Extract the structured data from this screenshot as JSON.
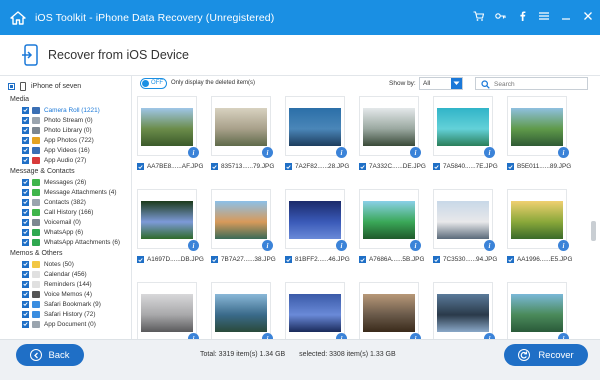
{
  "window": {
    "title": "iOS Toolkit - iPhone Data Recovery (Unregistered)",
    "tools": [
      "cart-icon",
      "key-icon",
      "facebook-icon",
      "menu-icon",
      "minimize-icon",
      "close-icon"
    ]
  },
  "header": {
    "title": "Recover from iOS Device"
  },
  "sidebar": {
    "device": "iPhone of seven",
    "groups": [
      {
        "title": "Media",
        "items": [
          {
            "label": "Camera Roll (1221)",
            "icon_color": "#3a6fb4",
            "active": true
          },
          {
            "label": "Photo Stream (0)",
            "icon_color": "#9aa4ae"
          },
          {
            "label": "Photo Library (0)",
            "icon_color": "#7d8791"
          },
          {
            "label": "App Photos (722)",
            "icon_color": "#e5a321"
          },
          {
            "label": "App Videos (16)",
            "icon_color": "#3a6fb4"
          },
          {
            "label": "App Audio (27)",
            "icon_color": "#d83a3a"
          }
        ]
      },
      {
        "title": "Message & Contacts",
        "items": [
          {
            "label": "Messages (26)",
            "icon_color": "#3fb54a"
          },
          {
            "label": "Message Attachments (4)",
            "icon_color": "#3fb54a"
          },
          {
            "label": "Contacts (382)",
            "icon_color": "#9aa4ae"
          },
          {
            "label": "Call History (166)",
            "icon_color": "#3fb54a"
          },
          {
            "label": "Voicemail (0)",
            "icon_color": "#7d8791"
          },
          {
            "label": "WhatsApp (6)",
            "icon_color": "#2fa84f"
          },
          {
            "label": "WhatsApp Attachments (6)",
            "icon_color": "#2fa84f"
          }
        ]
      },
      {
        "title": "Memos & Others",
        "items": [
          {
            "label": "Notes (50)",
            "icon_color": "#f2c744"
          },
          {
            "label": "Calendar (456)",
            "icon_color": "#e0e0e0"
          },
          {
            "label": "Reminders (144)",
            "icon_color": "#e0e0e0"
          },
          {
            "label": "Voice Memos (4)",
            "icon_color": "#555555"
          },
          {
            "label": "Safari Bookmark (9)",
            "icon_color": "#3a8de0"
          },
          {
            "label": "Safari History (72)",
            "icon_color": "#3a8de0"
          },
          {
            "label": "App Document (0)",
            "icon_color": "#9aa4ae"
          }
        ]
      }
    ]
  },
  "filter": {
    "toggle_state": "OFF",
    "toggle_label": "Only display the deleted item(s)",
    "show_by_label": "Show by:",
    "show_by_value": "All",
    "search_placeholder": "Search"
  },
  "photos": [
    {
      "name": "AA7BE8......AF.JPG",
      "colors": [
        "#9fc6e8",
        "#6b8c4a",
        "#3b5a2a"
      ]
    },
    {
      "name": "835713......79.JPG",
      "colors": [
        "#d8d2c0",
        "#a8a08a",
        "#5f6a4a"
      ]
    },
    {
      "name": "7A2F82......28.JPG",
      "colors": [
        "#2b6fa8",
        "#4a86b8",
        "#1d3d5e"
      ]
    },
    {
      "name": "7A332C......DE.JPG",
      "colors": [
        "#e4e8ea",
        "#9aa8a0",
        "#3a4a38"
      ]
    },
    {
      "name": "7A5840......7E.JPG",
      "colors": [
        "#31b4c8",
        "#63d1d8",
        "#2a7f5a"
      ]
    },
    {
      "name": "B5E011......89.JPG",
      "colors": [
        "#8fc0e0",
        "#5f9a4a",
        "#2f5a34"
      ]
    },
    {
      "name": "A1697D......DB.JPG",
      "colors": [
        "#1b3a1a",
        "#7d9ad8",
        "#2f6a2a"
      ]
    },
    {
      "name": "7B7A27......38.JPG",
      "colors": [
        "#8cc0e8",
        "#d89a5a",
        "#3a6a58"
      ]
    },
    {
      "name": "81BFF2......46.JPG",
      "colors": [
        "#1b2a6a",
        "#3a5ab8",
        "#6a8ad8"
      ]
    },
    {
      "name": "A7686A......5B.JPG",
      "colors": [
        "#8ad0e8",
        "#3aa858",
        "#1f5a2a"
      ]
    },
    {
      "name": "7C3530......94.JPG",
      "colors": [
        "#c8d8e8",
        "#e8e8ea",
        "#5a6a7a"
      ]
    },
    {
      "name": "AA1996......E5.JPG",
      "colors": [
        "#f0d070",
        "#8aa83a",
        "#3a6a2a"
      ]
    },
    {
      "name": "",
      "colors": [
        "#d8d8da",
        "#a8a8aa",
        "#5a5a5c"
      ]
    },
    {
      "name": "",
      "colors": [
        "#8ab8d8",
        "#3a6a8a",
        "#2a4a3a"
      ]
    },
    {
      "name": "",
      "colors": [
        "#3a5aa8",
        "#6a8ad8",
        "#1a2a5a"
      ]
    },
    {
      "name": "",
      "colors": [
        "#b89878",
        "#6a5a4a",
        "#3a2a1a"
      ]
    },
    {
      "name": "",
      "colors": [
        "#5a7a9a",
        "#2a3a4a",
        "#8aa8c8"
      ]
    },
    {
      "name": "",
      "colors": [
        "#7ab8d8",
        "#4a8a5a",
        "#2a5a3a"
      ]
    }
  ],
  "footer": {
    "back_label": "Back",
    "total": "Total: 3319 item(s) 1.34 GB",
    "selected": "selected: 3308 item(s) 1.33 GB",
    "recover_label": "Recover"
  }
}
